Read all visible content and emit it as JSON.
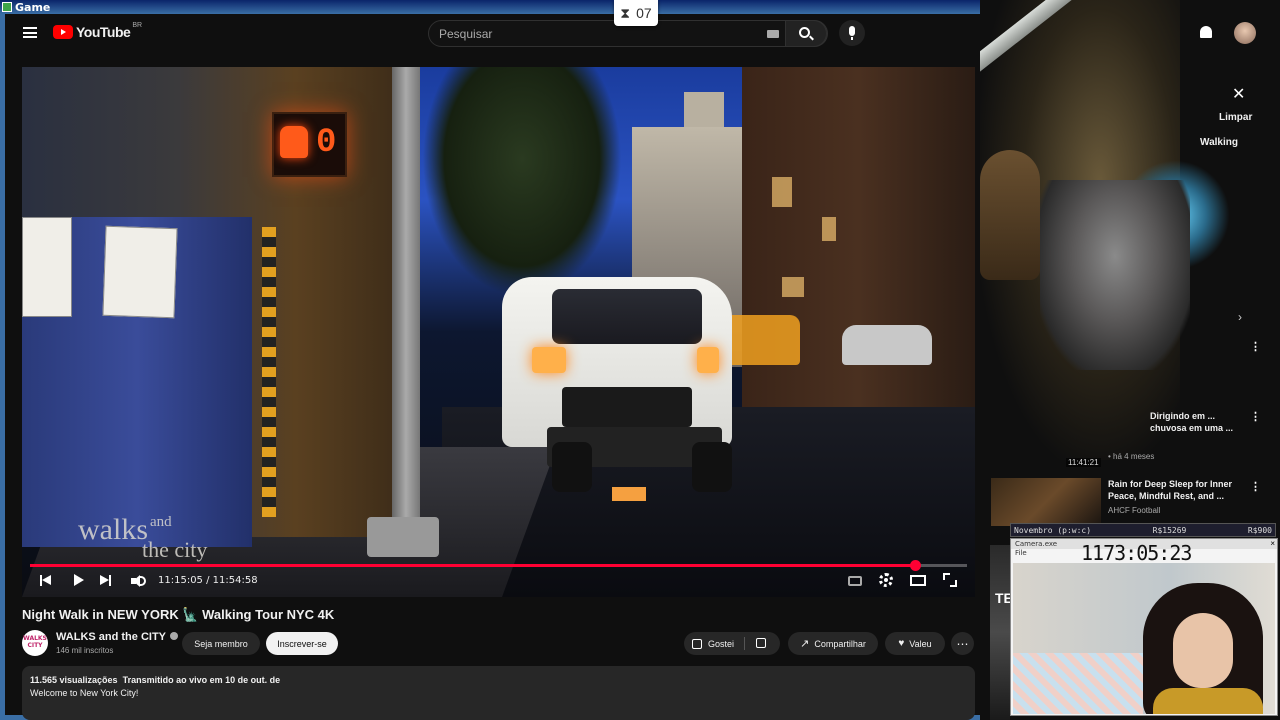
{
  "window": {
    "title": "Game"
  },
  "timer": {
    "icon": "hourglass-icon",
    "value": "07"
  },
  "header": {
    "logo": "YouTube",
    "country": "BR",
    "search_placeholder": "Pesquisar"
  },
  "player": {
    "current_time": "11:15:05",
    "duration": "11:54:58",
    "time_display": "11:15:05 / 11:54:58",
    "progress": 0.944,
    "watermark": "walks",
    "watermark_and": "and",
    "watermark_city": "the city",
    "walk_sign_count": "0"
  },
  "video": {
    "title": "Night Walk in NEW YORK 🗽 Walking Tour NYC 4K",
    "channel": "WALKS and the CITY",
    "channel_avatar": "WALKS and the CITY",
    "subscribers": "146 mil inscritos",
    "member_label": "Seja membro",
    "subscribe_label": "Inscrever-se",
    "like_label": "Gostei",
    "share_label": "Compartilhar",
    "thanks_label": "Valeu",
    "more_label": "⋯",
    "views": "11.565 visualizações",
    "streamed": "Transmitido ao vivo em 10 de out. de",
    "description": "Welcome to New York City!"
  },
  "sidebar": {
    "close": "✕",
    "clear": "Limpar",
    "chip": "Walking",
    "related": [
      {
        "title": "Dirigindo em ... chuvosa em uma ...",
        "meta": "• há 4 meses",
        "duration": "11:41:21"
      },
      {
        "title": "Rain for Deep Sleep for Inner Peace, Mindful Rest, and ...",
        "channel": "AHCF Football"
      }
    ]
  },
  "obs": {
    "label": "Novembro (p:w:c)",
    "value1": "R$15269",
    "value2": "R$900"
  },
  "camera": {
    "title": "Camera.exe",
    "menu": "File",
    "clock": "1173:05:23"
  }
}
